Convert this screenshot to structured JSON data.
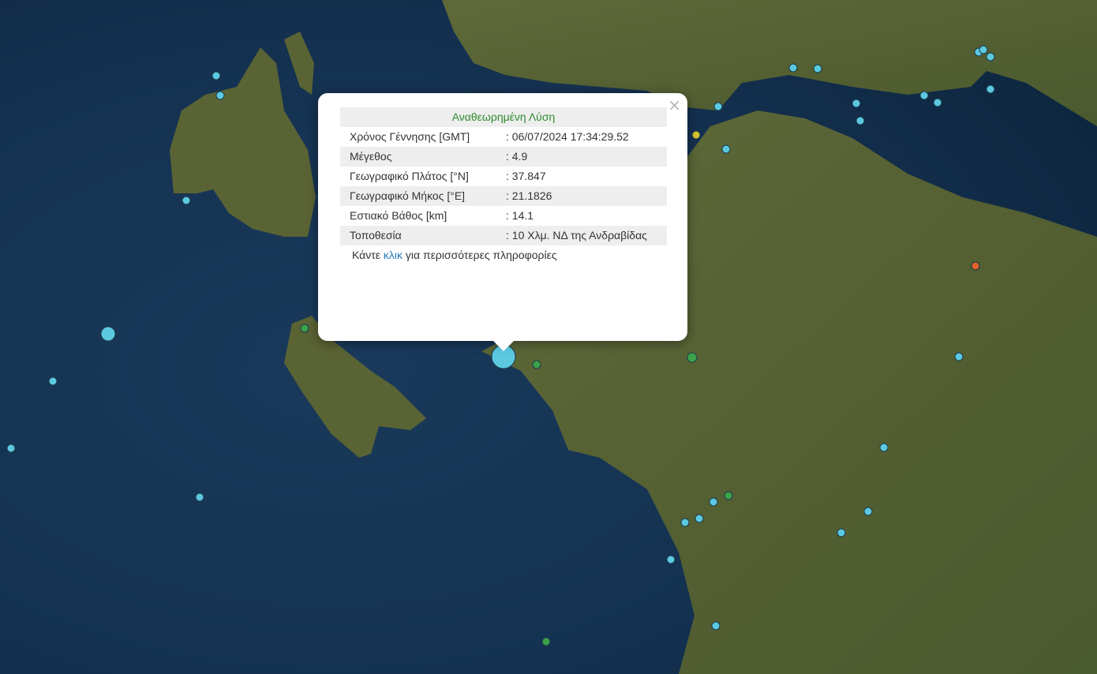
{
  "popup": {
    "title": "Αναθεωρημένη Λύση",
    "rows": [
      {
        "key": "Χρόνος Γέννησης [GMT]",
        "value": ": 06/07/2024 17:34:29.52"
      },
      {
        "key": "Μέγεθος",
        "value": ": 4.9"
      },
      {
        "key": "Γεωγραφικό Πλάτος [°N]",
        "value": ": 37.847"
      },
      {
        "key": "Γεωγραφικό Μήκος [°E]",
        "value": ": 21.1826"
      },
      {
        "key": "Εστιακό Βάθος [km]",
        "value": ": 14.1"
      },
      {
        "key": "Τοποθεσία",
        "value": ": 10 Χλμ. ΝΔ της Ανδραβίδας"
      }
    ],
    "more_prefix": "Κάντε ",
    "more_link": "κλικ",
    "more_suffix": " για περισσότερες πληροφορίες",
    "close_glyph": "×"
  },
  "colors": {
    "sea": "#14304d",
    "land": "#5a6534",
    "marker_cyan": "#5cc9e0",
    "marker_green": "#3aa24a",
    "marker_yellow": "#d8c232",
    "marker_orange": "#e2622a"
  }
}
